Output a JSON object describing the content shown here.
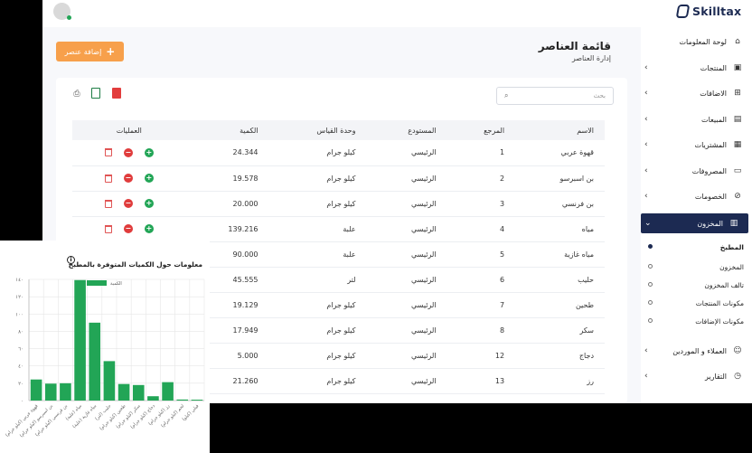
{
  "brand": {
    "name": "Skilltax"
  },
  "page": {
    "title": "قائمة العناصر",
    "subtitle": "إدارة العناصر",
    "add_label": "إضافة عنصر"
  },
  "search": {
    "placeholder": "بحث"
  },
  "table": {
    "headers": [
      "الاسم",
      "المرجع",
      "المستودع",
      "وحدة القياس",
      "الكمية",
      "العمليات"
    ],
    "rows": [
      [
        "قهوة عربي",
        "1",
        "الرئيسي",
        "كيلو جرام",
        "24.344"
      ],
      [
        "بن اسبرسو",
        "2",
        "الرئيسي",
        "كيلو جرام",
        "19.578"
      ],
      [
        "بن فرنسي",
        "3",
        "الرئيسي",
        "كيلو جرام",
        "20.000"
      ],
      [
        "مياه",
        "4",
        "الرئيسي",
        "علبة",
        "139.216"
      ],
      [
        "مياه غازية",
        "5",
        "الرئيسي",
        "علبة",
        "90.000"
      ],
      [
        "حليب",
        "6",
        "الرئيسي",
        "لتر",
        "45.555"
      ],
      [
        "طحين",
        "7",
        "الرئيسي",
        "كيلو جرام",
        "19.129"
      ],
      [
        "سكر",
        "8",
        "الرئيسي",
        "كيلو جرام",
        "17.949"
      ],
      [
        "دجاج",
        "12",
        "الرئيسي",
        "كيلو جرام",
        "5.000"
      ],
      [
        "رز",
        "13",
        "الرئيسي",
        "كيلو جرام",
        "21.260"
      ]
    ]
  },
  "sidebar": {
    "items": [
      {
        "label": "لوحة المعلومات",
        "icon": "dashboard-icon",
        "glyph": "⌂",
        "chevron": false
      },
      {
        "label": "المنتجات",
        "icon": "box-icon",
        "glyph": "▣",
        "chevron": true
      },
      {
        "label": "الاضافات",
        "icon": "addons-icon",
        "glyph": "⊞",
        "chevron": true
      },
      {
        "label": "المبيعات",
        "icon": "sales-icon",
        "glyph": "▤",
        "chevron": true
      },
      {
        "label": "المشتريات",
        "icon": "purchases-icon",
        "glyph": "▦",
        "chevron": true
      },
      {
        "label": "المصروفات",
        "icon": "expenses-icon",
        "glyph": "▭",
        "chevron": true
      },
      {
        "label": "الخصومات",
        "icon": "discount-icon",
        "glyph": "⊘",
        "chevron": true
      },
      {
        "label": "المخزون",
        "icon": "inventory-icon",
        "glyph": "▥",
        "chevron": true,
        "active": true
      },
      {
        "label": "العملاء و الموردين",
        "icon": "users-icon",
        "glyph": "☺",
        "chevron": true
      },
      {
        "label": "التقارير",
        "icon": "reports-icon",
        "glyph": "◷",
        "chevron": true
      }
    ],
    "sub_items": [
      {
        "label": "المطبخ",
        "active": true
      },
      {
        "label": "المخزون",
        "active": false
      },
      {
        "label": "تالف المخزون",
        "active": false
      },
      {
        "label": "مكونات المنتجات",
        "active": false
      },
      {
        "label": "مكونات الإضافات",
        "active": false
      }
    ]
  },
  "chart": {
    "title": "معلومات حول الكميات المتوفرة بالمطبخ",
    "legend": "الكمية",
    "bar_color": "#22a556"
  },
  "chart_data": {
    "type": "bar",
    "title": "معلومات حول الكميات المتوفرة بالمطبخ",
    "categories": [
      "قهوة عربي (كيلو جرام)",
      "بن اسبرسو (كيلو جرام)",
      "بن فرنسي (كيلو جرام)",
      "مياه (علبة)",
      "مياه غازية (علبة)",
      "حليب (لتر)",
      "طحين (كيلو جرام)",
      "سكر (كيلو جرام)",
      "دجاج (كيلو جرام)",
      "رز (كيلو جرام)",
      "لحم (كيلو جرام)",
      "فيلي (كيلو)"
    ],
    "series": [
      {
        "name": "الكمية",
        "values": [
          24.344,
          19.578,
          20.0,
          139.216,
          90.0,
          45.555,
          19.129,
          17.949,
          5.0,
          21.26,
          1.2,
          1.0
        ]
      }
    ],
    "y_ticks": [
      "٠",
      "٢٠",
      "٤٠",
      "٦٠",
      "٨٠",
      "١٠٠",
      "١٢٠",
      "١٤٠"
    ],
    "ylim": [
      0,
      140
    ],
    "grid": true,
    "legend_position": "top-center"
  },
  "colors": {
    "navy": "#1c2a52",
    "orange": "#f7a04b",
    "green": "#22a556",
    "red": "#e03c3c"
  }
}
